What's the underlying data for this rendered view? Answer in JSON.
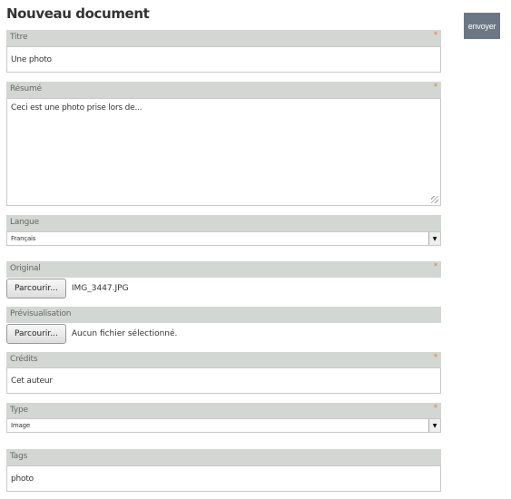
{
  "page_title": "Nouveau document",
  "submit_label": "envoyer",
  "required_mark": "*",
  "fields": {
    "titre": {
      "label": "Titre",
      "value": "Une photo"
    },
    "resume": {
      "label": "Résumé",
      "value": "Ceci est une photo prise lors de..."
    },
    "langue": {
      "label": "Langue",
      "value": "Français"
    },
    "original": {
      "label": "Original",
      "button": "Parcourir...",
      "file": "IMG_3447.JPG"
    },
    "previsualisation": {
      "label": "Prévisualisation",
      "button": "Parcourir...",
      "file": "Aucun fichier sélectionné."
    },
    "credits": {
      "label": "Crédits",
      "value": "Cet auteur"
    },
    "type": {
      "label": "Type",
      "value": "Image"
    },
    "tags": {
      "label": "Tags",
      "value": "photo"
    }
  },
  "colors": {
    "header_bg": "#d3d7d3",
    "button_bg": "#6b7785",
    "required": "#e08040"
  }
}
